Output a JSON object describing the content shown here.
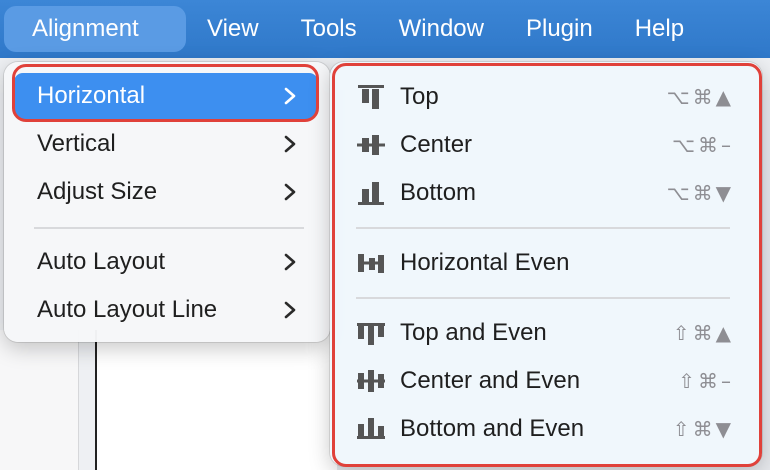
{
  "menubar": {
    "items": [
      "Alignment",
      "View",
      "Tools",
      "Window",
      "Plugin",
      "Help"
    ]
  },
  "alignment_menu": {
    "items": [
      "Horizontal",
      "Vertical",
      "Adjust Size",
      "Auto Layout",
      "Auto Layout Line"
    ],
    "selected": "Horizontal"
  },
  "horizontal_submenu": {
    "items": [
      {
        "label": "Top",
        "shortcut": "⌥⌘▲",
        "icon": "align-top-icon"
      },
      {
        "label": "Center",
        "shortcut": "⌥⌘–",
        "icon": "align-center-icon"
      },
      {
        "label": "Bottom",
        "shortcut": "⌥⌘▼",
        "icon": "align-bottom-icon"
      },
      {
        "label": "Horizontal Even",
        "shortcut": "",
        "icon": "distribute-horizontal-icon"
      },
      {
        "label": "Top and Even",
        "shortcut": "⇧⌘▲",
        "icon": "top-even-icon"
      },
      {
        "label": "Center and Even",
        "shortcut": "⇧⌘–",
        "icon": "center-even-icon"
      },
      {
        "label": "Bottom and Even",
        "shortcut": "⇧⌘▼",
        "icon": "bottom-even-icon"
      }
    ]
  },
  "colors": {
    "menubar": "#3580d0",
    "highlight": "#3d8ff0",
    "annotation_outline": "#e0413a"
  }
}
